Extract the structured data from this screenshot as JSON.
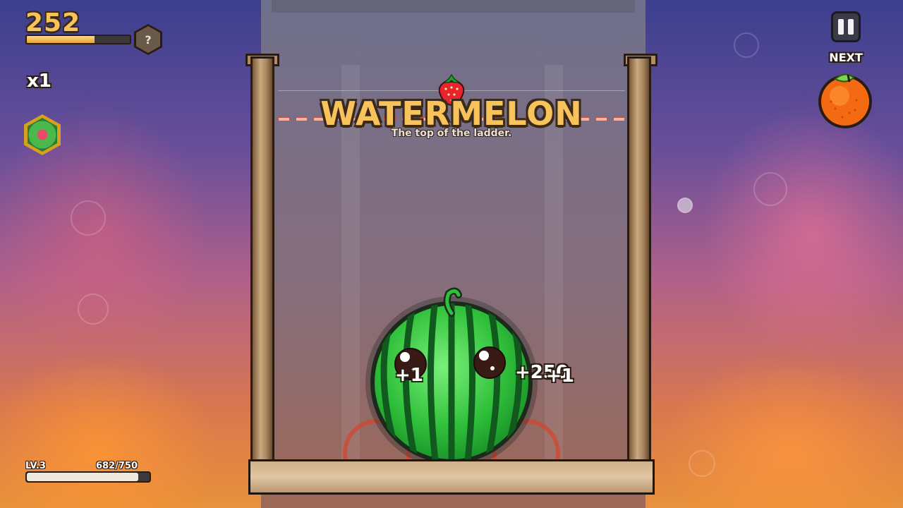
{
  "hud": {
    "score": "252",
    "score_progress": 0.66,
    "mystery_label": "?",
    "multiplier": "x1",
    "powerup_icon": "gem-badge-icon"
  },
  "top_right": {
    "pause_icon": "pause-icon",
    "next_label": "NEXT",
    "next_fruit": "orange"
  },
  "announcement": {
    "title": "WATERMELON",
    "subtitle": "The top of the ladder.",
    "dropper_fruit": "strawberry"
  },
  "board": {
    "fruit": "watermelon",
    "score_popups": [
      "+1",
      "+250",
      "+1"
    ]
  },
  "level": {
    "label": "LV.3",
    "xp": "682/750",
    "xp_progress": 0.909
  },
  "colors": {
    "gold": "#f7c35a",
    "outline": "#3a2a1c",
    "melon_green": "#2fbf3a",
    "melon_dark": "#0f5a1c"
  }
}
